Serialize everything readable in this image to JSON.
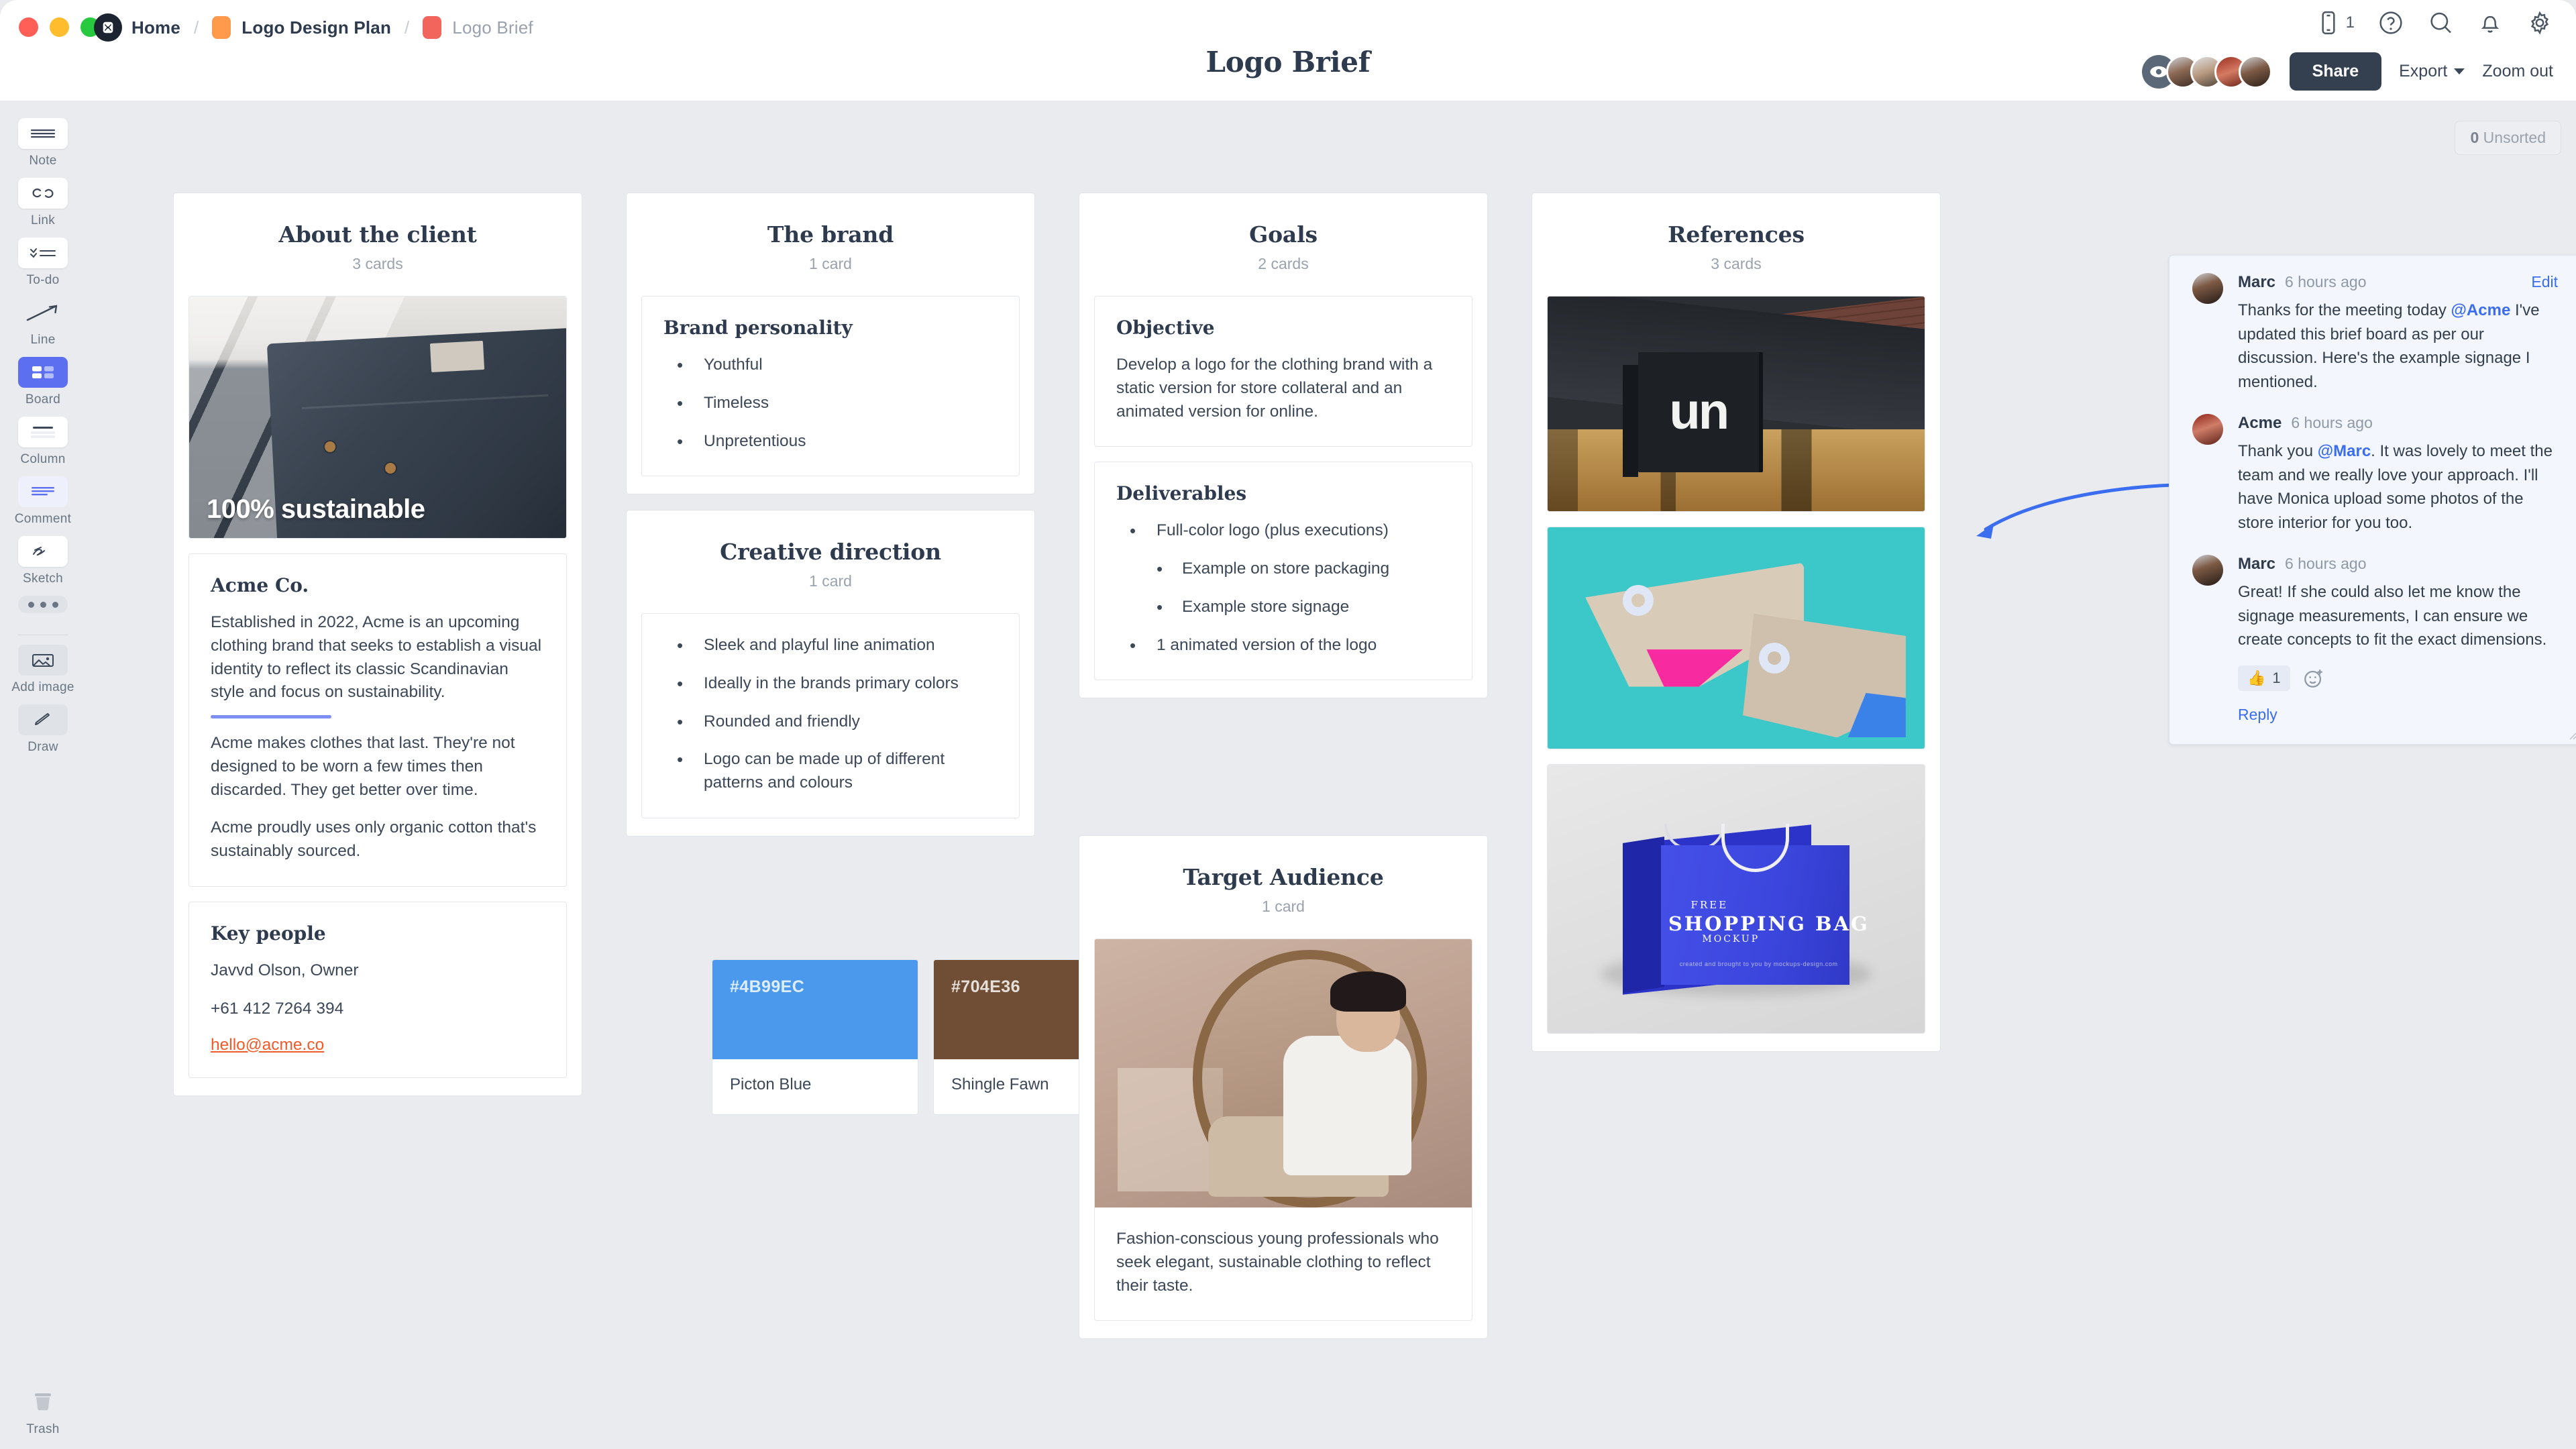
{
  "window": {
    "traffic_lights": [
      "close",
      "minimize",
      "maximize"
    ]
  },
  "breadcrumb": {
    "home": "Home",
    "sep": "/",
    "project": "Logo Design Plan",
    "current": "Logo Brief"
  },
  "header": {
    "doc_title": "Logo Brief",
    "device_count": "1",
    "icons": [
      "mobile-icon",
      "help-icon",
      "search-icon",
      "notifications-icon",
      "settings-icon"
    ],
    "share_label": "Share",
    "export_label": "Export",
    "zoom_out_label": "Zoom out"
  },
  "sidebar": {
    "tools": [
      {
        "label": "Note",
        "icon": "note-icon"
      },
      {
        "label": "Link",
        "icon": "link-icon"
      },
      {
        "label": "To-do",
        "icon": "todo-icon"
      },
      {
        "label": "Line",
        "icon": "line-icon"
      },
      {
        "label": "Board",
        "icon": "board-icon",
        "active": true
      },
      {
        "label": "Column",
        "icon": "column-icon"
      },
      {
        "label": "Comment",
        "icon": "comment-icon"
      },
      {
        "label": "Sketch",
        "icon": "sketch-icon"
      }
    ],
    "more_label": "More",
    "add_image_label": "Add image",
    "draw_label": "Draw",
    "trash_label": "Trash"
  },
  "board": {
    "unsorted_count": "0",
    "unsorted_label": "Unsorted",
    "columns": [
      {
        "title": "About the client",
        "cards_count": "3 cards",
        "image_caption": "100% sustainable",
        "card_heading": "Acme Co.",
        "paragraphs": [
          "Established in 2022, Acme is an upcoming clothing brand that seeks to establish a visual identity to reflect its classic Scandinavian style and focus on sustainability.",
          "Acme makes clothes that last. They're not designed to be worn a few times then discarded. They get better over time.",
          "Acme proudly uses only organic cotton that's sustainably sourced."
        ],
        "key_people_heading": "Key people",
        "key_people": [
          "Javvd Olson, Owner",
          "+61 412 7264 394"
        ],
        "key_people_email": "hello@acme.co"
      },
      {
        "title": "The brand",
        "cards_count": "1 card",
        "card_heading": "Brand personality",
        "bullets": [
          "Youthful",
          "Timeless",
          "Unpretentious"
        ]
      },
      {
        "title": "Creative direction",
        "cards_count": "1 card",
        "bullets": [
          "Sleek and playful line animation",
          "Ideally in the brands primary colors",
          "Rounded and friendly",
          "Logo can be made up of different patterns and colours"
        ],
        "swatches": [
          {
            "hex": "#4B99EC",
            "name": "Picton Blue"
          },
          {
            "hex": "#704E36",
            "name": "Shingle Fawn"
          }
        ]
      },
      {
        "title": "Goals",
        "cards_count": "2 cards",
        "objective_heading": "Objective",
        "objective_text": "Develop a logo for the clothing brand with a static version for store collateral and an animated version for online.",
        "deliverables_heading": "Deliverables",
        "deliverables": [
          "Full-color logo (plus executions)",
          "1 animated version of the logo"
        ],
        "deliverables_sub": [
          "Example on store packaging",
          "Example store signage"
        ]
      },
      {
        "title": "Target Audience",
        "cards_count": "1 card",
        "caption": "Fashion-conscious young professionals who seek elegant, sustainable clothing to reflect their taste."
      },
      {
        "title": "References",
        "cards_count": "3 cards",
        "images": [
          "storefront-signage-un",
          "paper-tags-teal",
          "blue-shopping-bag"
        ],
        "signage_text": "un",
        "bag_text_free": "FREE",
        "bag_text_main": "SHOPPING BAG",
        "bag_text_sub": "MOCKUP",
        "bag_text_credit": "created and brought to you by mockups-design.com"
      }
    ]
  },
  "comment_thread": {
    "comments": [
      {
        "author": "Marc",
        "time": "6 hours ago",
        "edit_label": "Edit",
        "text_before": "Thanks for the meeting today ",
        "mention": "@Acme",
        "text_after": "  I've updated this brief board as per our discussion. Here's the example signage I mentioned."
      },
      {
        "author": "Acme",
        "time": "6 hours ago",
        "text_before": "Thank you ",
        "mention": "@Marc",
        "text_after": ".  It was lovely to meet the team and we really love your approach. I'll have Monica upload some photos of the store interior for you too."
      },
      {
        "author": "Marc",
        "time": "6 hours ago",
        "text_before": "Great! If she could also let me know the signage measurements, I can ensure we create concepts to fit the exact dimensions.",
        "mention": "",
        "text_after": ""
      }
    ],
    "reaction_emoji": "👍",
    "reaction_count": "1",
    "reply_label": "Reply"
  },
  "colors": {
    "accent_blue": "#3a6df0",
    "link_orange": "#f15a29",
    "picton_blue": "#4B99EC",
    "shingle_fawn": "#704E36",
    "board_bg": "#e9ebee",
    "dark_text": "#2e3a4d"
  }
}
